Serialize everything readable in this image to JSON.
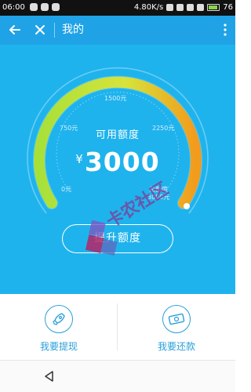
{
  "status_bar": {
    "time": "06:00",
    "network_speed": "4.80K/s",
    "battery": "76"
  },
  "nav": {
    "title": "我的"
  },
  "gauge": {
    "labels": {
      "tick_0": "0元",
      "tick_750": "750元",
      "tick_1500": "1500元",
      "tick_2250": "2250元",
      "total_label": "总额度",
      "total_value": "3000元"
    },
    "available_title": "可用额度",
    "currency": "¥",
    "available_amount": "3000",
    "fill_fraction": 1.0,
    "colors": {
      "start": "#a8e03a",
      "end": "#f29b1c",
      "background": "#1fb3ed"
    }
  },
  "raise_button": {
    "label": "提升额度"
  },
  "watermark": {
    "text": "卡农社区"
  },
  "actions": {
    "withdraw": {
      "label": "我要提现",
      "icon": "rocket-icon"
    },
    "repay": {
      "label": "我要还款",
      "icon": "money-icon"
    }
  },
  "theme": {
    "primary": "#1fa3e6",
    "accent_text": "#2a9fd9"
  }
}
